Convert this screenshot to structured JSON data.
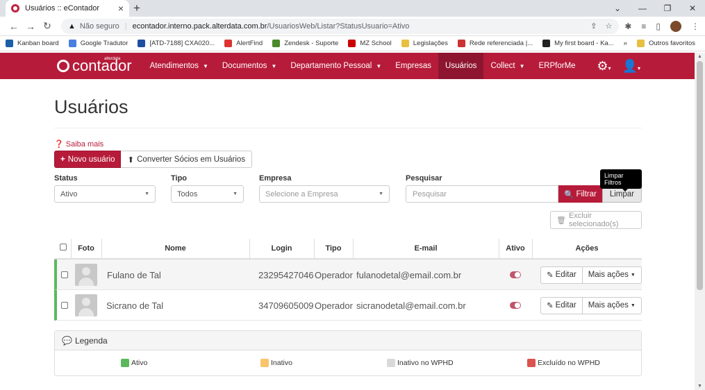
{
  "browser": {
    "tab_title": "Usuários :: eContador",
    "url_warning": "Não seguro",
    "url_domain": "econtador.interno.pack.alterdata.com.br",
    "url_path": "/UsuariosWeb/Listar?StatusUsuario=Ativo",
    "bookmarks": [
      "Kanban board",
      "Google Tradutor",
      "[ATD-7188] CXA020...",
      "AlertFind",
      "Zendesk - Suporte",
      "MZ School",
      "Legislações",
      "Rede referenciada |...",
      "My first board - Ka..."
    ],
    "bookmark_colors": [
      "#1b5fa8",
      "#4a7fe0",
      "#1e4fa0",
      "#d33",
      "#4a8a2a",
      "#c00",
      "#e8c040",
      "#c33",
      "#222"
    ],
    "bookmarks_more": "»",
    "other_bookmarks": "Outros favoritos"
  },
  "app": {
    "logo_text": "contador",
    "logo_sub": "alterdata",
    "menu": [
      {
        "label": "Atendimentos",
        "dropdown": true,
        "active": false
      },
      {
        "label": "Documentos",
        "dropdown": true,
        "active": false
      },
      {
        "label": "Departamento Pessoal",
        "dropdown": true,
        "active": false
      },
      {
        "label": "Empresas",
        "dropdown": false,
        "active": false
      },
      {
        "label": "Usuários",
        "dropdown": false,
        "active": true
      },
      {
        "label": "Collect",
        "dropdown": true,
        "active": false
      },
      {
        "label": "ERPforMe",
        "dropdown": false,
        "active": false
      }
    ],
    "brand_color": "#b71b3a"
  },
  "page": {
    "title": "Usuários",
    "saiba_mais": "Saiba mais",
    "novo_usuario": "Novo usuário",
    "converter_socios": "Converter Sócios em Usuários",
    "filters": {
      "status_label": "Status",
      "status_value": "Ativo",
      "tipo_label": "Tipo",
      "tipo_value": "Todos",
      "empresa_label": "Empresa",
      "empresa_placeholder": "Selecione a Empresa",
      "pesquisar_label": "Pesquisar",
      "pesquisar_placeholder": "Pesquisar",
      "filtrar_button": "Filtrar",
      "limpar_button": "Limpar",
      "tooltip": "Limpar Filtros"
    },
    "excluir_selecionados": "Excluir selecionado(s)",
    "table": {
      "headers": {
        "foto": "Foto",
        "nome": "Nome",
        "login": "Login",
        "tipo": "Tipo",
        "email": "E-mail",
        "ativo": "Ativo",
        "acoes": "Ações"
      },
      "rows": [
        {
          "nome": "Fulano de Tal",
          "login": "23295427046",
          "tipo": "Operador",
          "email": "fulanodetal@email.com.br",
          "ativo": true,
          "status_color": "#5cb85c"
        },
        {
          "nome": "Sicrano de Tal",
          "login": "34709605009",
          "tipo": "Operador",
          "email": "sicranodetal@email.com.br",
          "ativo": true,
          "status_color": "#5cb85c"
        }
      ],
      "editar": "Editar",
      "mais_acoes": "Mais ações"
    },
    "legend": {
      "title": "Legenda",
      "items": [
        {
          "label": "Ativo",
          "color": "#5cb85c"
        },
        {
          "label": "Inativo",
          "color": "#f9c46b"
        },
        {
          "label": "Inativo no WPHD",
          "color": "#d9d9d9"
        },
        {
          "label": "Excluído no WPHD",
          "color": "#d9534f"
        }
      ]
    }
  }
}
